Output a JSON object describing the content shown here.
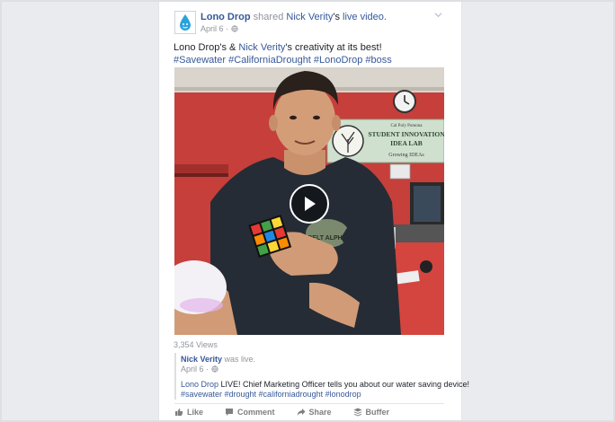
{
  "post": {
    "page_name": "Lono Drop",
    "shared_text": "shared",
    "shared_author": "Nick Verity",
    "possessive": "'s",
    "shared_object": "live video.",
    "date": "April 6 ·",
    "text_part1": "Lono Drop's & ",
    "text_mention": "Nick Verity",
    "text_part2": "'s creativity at its best!",
    "hashtags": "#Savewater #CaliforniaDrought #LonoDrop #boss",
    "views": "3,354 Views"
  },
  "shared_post": {
    "author": "Nick Verity",
    "status": "was live.",
    "date": "April 6 ·",
    "page": "Lono Drop",
    "text": " LIVE! Chief Marketing Officer tells you about our water saving device!",
    "hashtags": "#savewater #drought #californiadrought #lonodrop"
  },
  "video": {
    "sign_line1": "Cal Poly Pomona",
    "sign_line2": "STUDENT INNOVATION",
    "sign_line3": "IDEA LAB",
    "sign_line4": "Growing IDEAs",
    "shirt_text": "DELT ALPHA"
  },
  "actions": {
    "like": "Like",
    "comment": "Comment",
    "share": "Share",
    "buffer": "Buffer"
  },
  "icons": {
    "avatar": "water-drop-icon",
    "privacy": "globe-icon",
    "menu": "chevron-down-icon",
    "play": "play-icon"
  },
  "colors": {
    "link": "#365899",
    "muted": "#90949c",
    "accent_drop": "#2aa3dd"
  }
}
